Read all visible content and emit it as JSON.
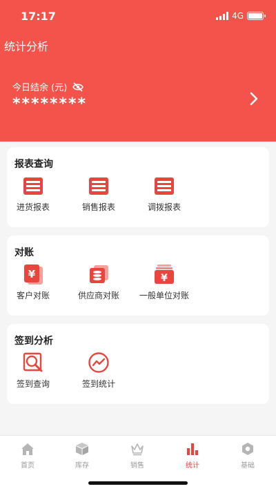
{
  "status_bar": {
    "time": "17:17",
    "network": "4G"
  },
  "header": {
    "title": "统计分析",
    "balance_label": "今日结余 (元)",
    "balance_value": "********"
  },
  "sections": {
    "reports": {
      "title": "报表查询",
      "items": [
        {
          "label": "进货报表",
          "icon": "report-icon"
        },
        {
          "label": "销售报表",
          "icon": "report-icon"
        },
        {
          "label": "调拨报表",
          "icon": "report-icon"
        }
      ]
    },
    "reconciliation": {
      "title": "对账",
      "items": [
        {
          "label": "客户对账",
          "icon": "yen-card-icon"
        },
        {
          "label": "供应商对账",
          "icon": "supplier-stack-icon"
        },
        {
          "label": "一般单位对账",
          "icon": "yen-box-icon"
        }
      ]
    },
    "checkin": {
      "title": "签到分析",
      "items": [
        {
          "label": "签到查询",
          "icon": "search-icon"
        },
        {
          "label": "签到统计",
          "icon": "trend-icon"
        }
      ]
    }
  },
  "tabbar": {
    "active": "统计",
    "tabs": [
      {
        "label": "首页",
        "icon": "home-icon"
      },
      {
        "label": "库存",
        "icon": "box-icon"
      },
      {
        "label": "销售",
        "icon": "crown-icon"
      },
      {
        "label": "统计",
        "icon": "bar-chart-icon"
      },
      {
        "label": "基础",
        "icon": "hexagon-icon"
      }
    ]
  },
  "colors": {
    "accent": "#f4534c",
    "icon_red": "#e8453d",
    "inactive": "#b5b5b5"
  }
}
